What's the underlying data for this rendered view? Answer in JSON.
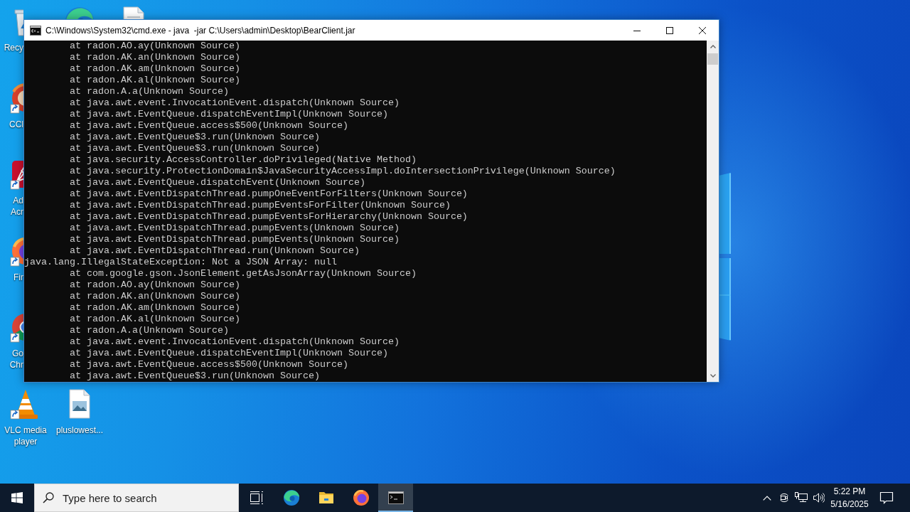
{
  "desktop": {
    "icons": [
      {
        "kind": "recycle-bin",
        "label_lines": [
          "Recy"
        ],
        "shortcut": false
      },
      {
        "kind": "ccleaner",
        "label_lines": [
          "CCl"
        ],
        "shortcut": true
      },
      {
        "kind": "acrobat",
        "label_lines": [
          "Ad",
          "Acr"
        ],
        "shortcut": true
      },
      {
        "kind": "firefox",
        "label_lines": [
          "Fir"
        ],
        "shortcut": true
      },
      {
        "kind": "chrome",
        "label_lines": [
          "Go",
          "Chr"
        ],
        "shortcut": true
      },
      {
        "kind": "vlc",
        "label_lines": [
          "VLC media",
          "player"
        ],
        "shortcut": true
      },
      {
        "kind": "edge"
      },
      {
        "kind": "image-file",
        "label_lines": [
          "pluslowest..."
        ],
        "shortcut": false
      },
      {
        "kind": "document"
      }
    ]
  },
  "window": {
    "title": "C:\\Windows\\System32\\cmd.exe - java  -jar C:\\Users\\admin\\Desktop\\BearClient.jar",
    "lines": [
      {
        "kind": "frame",
        "text": "at radon.AO.ay(Unknown Source)"
      },
      {
        "kind": "frame",
        "text": "at radon.AK.an(Unknown Source)"
      },
      {
        "kind": "frame",
        "text": "at radon.AK.am(Unknown Source)"
      },
      {
        "kind": "frame",
        "text": "at radon.AK.al(Unknown Source)"
      },
      {
        "kind": "frame",
        "text": "at radon.A.a(Unknown Source)"
      },
      {
        "kind": "frame",
        "text": "at java.awt.event.InvocationEvent.dispatch(Unknown Source)"
      },
      {
        "kind": "frame",
        "text": "at java.awt.EventQueue.dispatchEventImpl(Unknown Source)"
      },
      {
        "kind": "frame",
        "text": "at java.awt.EventQueue.access$500(Unknown Source)"
      },
      {
        "kind": "frame",
        "text": "at java.awt.EventQueue$3.run(Unknown Source)"
      },
      {
        "kind": "frame",
        "text": "at java.awt.EventQueue$3.run(Unknown Source)"
      },
      {
        "kind": "frame",
        "text": "at java.security.AccessController.doPrivileged(Native Method)"
      },
      {
        "kind": "frame",
        "text": "at java.security.ProtectionDomain$JavaSecurityAccessImpl.doIntersectionPrivilege(Unknown Source)"
      },
      {
        "kind": "frame",
        "text": "at java.awt.EventQueue.dispatchEvent(Unknown Source)"
      },
      {
        "kind": "frame",
        "text": "at java.awt.EventDispatchThread.pumpOneEventForFilters(Unknown Source)"
      },
      {
        "kind": "frame",
        "text": "at java.awt.EventDispatchThread.pumpEventsForFilter(Unknown Source)"
      },
      {
        "kind": "frame",
        "text": "at java.awt.EventDispatchThread.pumpEventsForHierarchy(Unknown Source)"
      },
      {
        "kind": "frame",
        "text": "at java.awt.EventDispatchThread.pumpEvents(Unknown Source)"
      },
      {
        "kind": "frame",
        "text": "at java.awt.EventDispatchThread.pumpEvents(Unknown Source)"
      },
      {
        "kind": "frame",
        "text": "at java.awt.EventDispatchThread.run(Unknown Source)"
      },
      {
        "kind": "message",
        "text": "java.lang.IllegalStateException: Not a JSON Array: null"
      },
      {
        "kind": "frame",
        "text": "at com.google.gson.JsonElement.getAsJsonArray(Unknown Source)"
      },
      {
        "kind": "frame",
        "text": "at radon.AO.ay(Unknown Source)"
      },
      {
        "kind": "frame",
        "text": "at radon.AK.an(Unknown Source)"
      },
      {
        "kind": "frame",
        "text": "at radon.AK.am(Unknown Source)"
      },
      {
        "kind": "frame",
        "text": "at radon.AK.al(Unknown Source)"
      },
      {
        "kind": "frame",
        "text": "at radon.A.a(Unknown Source)"
      },
      {
        "kind": "frame",
        "text": "at java.awt.event.InvocationEvent.dispatch(Unknown Source)"
      },
      {
        "kind": "frame",
        "text": "at java.awt.EventQueue.dispatchEventImpl(Unknown Source)"
      },
      {
        "kind": "frame",
        "text": "at java.awt.EventQueue.access$500(Unknown Source)"
      },
      {
        "kind": "frame",
        "text": "at java.awt.EventQueue$3.run(Unknown Source)"
      }
    ]
  },
  "taskbar": {
    "search": {
      "placeholder": "Type here to search"
    },
    "buttons": [
      {
        "kind": "task-view",
        "selected": false
      },
      {
        "kind": "edge",
        "selected": false
      },
      {
        "kind": "folder",
        "selected": false
      },
      {
        "kind": "firefox",
        "selected": false
      },
      {
        "kind": "terminal",
        "selected": true
      }
    ],
    "tray_icons": [
      {
        "kind": "chevron"
      },
      {
        "kind": "webcam"
      },
      {
        "kind": "network"
      },
      {
        "kind": "speaker"
      }
    ],
    "clock": {
      "time": "5:22 PM",
      "date": "5/16/2025"
    }
  }
}
